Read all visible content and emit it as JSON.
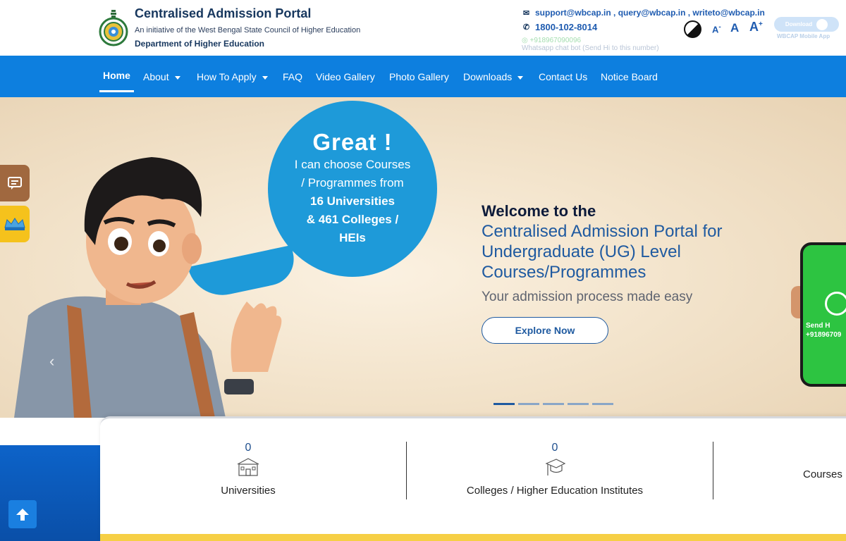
{
  "header": {
    "title": "Centralised Admission Portal",
    "subtitle": "An initiative of the West Bengal State Council of Higher Education",
    "department": "Department of Higher Education",
    "emails": "support@wbcap.in , query@wbcap.in , writeto@wbcap.in",
    "phone": "1800-102-8014",
    "whatsapp_number": "+918967090096",
    "whatsapp_label": "Whatsapp chat bot (Send Hi to this number)",
    "font_decrease": "A",
    "font_normal": "A",
    "font_increase": "A",
    "font_increase_sup": "+",
    "font_decrease_sup": "-",
    "app_badge_label": "Download",
    "app_caption": "WBCAP Mobile App"
  },
  "nav": {
    "items": [
      {
        "label": "Home"
      },
      {
        "label": "About"
      },
      {
        "label": "How To Apply"
      },
      {
        "label": "FAQ"
      },
      {
        "label": "Video Gallery"
      },
      {
        "label": "Photo Gallery"
      },
      {
        "label": "Downloads"
      },
      {
        "label": "Contact Us"
      },
      {
        "label": "Notice Board"
      }
    ]
  },
  "hero": {
    "bubble_great": "Great !",
    "bubble_line1": "I can choose Courses",
    "bubble_line2": "/ Programmes from",
    "bubble_line3": "16 Universities",
    "bubble_line4": "& 461 Colleges /",
    "bubble_line5": "HEIs",
    "welcome": "Welcome to the",
    "title_line1": "Centralised Admission Portal for",
    "title_line2": "Undergraduate (UG) Level",
    "title_line3": "Courses/Programmes",
    "tagline": "Your admission process made easy",
    "cta": "Explore Now",
    "phone_send": "Send H",
    "phone_number": "+91896709",
    "active_slide": 1,
    "slide_count": 5
  },
  "stats": [
    {
      "value": "0",
      "label": "Universities"
    },
    {
      "value": "0",
      "label": "Colleges / Higher Education Institutes"
    },
    {
      "value": "",
      "label": "Courses"
    }
  ],
  "colors": {
    "nav_bg": "#0d7fdf",
    "brand_dark": "#17375e",
    "accent_blue": "#1f5aa0",
    "bubble": "#1e9ad9",
    "yellow": "#f6cf45"
  },
  "icons": [
    "envelope-icon",
    "phone-icon",
    "whatsapp-icon",
    "contrast-icon",
    "android-icon",
    "chat-icon",
    "crown-icon",
    "arrow-up-icon",
    "university-icon",
    "graduate-icon"
  ]
}
